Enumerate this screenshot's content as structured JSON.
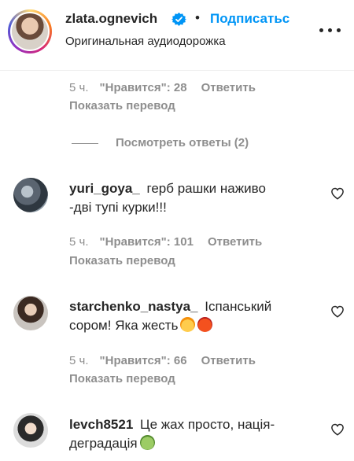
{
  "header": {
    "username": "zlata.ognevich",
    "separator": "•",
    "follow_label": "Подписатьс",
    "audio_label": "Оригинальная аудиодорожка"
  },
  "prev_comment": {
    "time": "5 ч.",
    "likes": "\"Нравится\": 28",
    "reply_label": "Ответить",
    "translate_label": "Показать перевод"
  },
  "view_replies_label": "Посмотреть ответы (2)",
  "comments": [
    {
      "user": "yuri_goya_",
      "text_line1": "герб рашки наживо",
      "text_line2": "-дві тупі курки!!!",
      "time": "5 ч.",
      "likes": "\"Нравится\": 101",
      "reply_label": "Ответить",
      "translate_label": "Показать перевод"
    },
    {
      "user": "starchenko_nastya_",
      "text_line1": "Іспанський",
      "text_line2": "сором! Яка жесть",
      "time": "5 ч.",
      "likes": "\"Нравится\": 66",
      "reply_label": "Ответить",
      "translate_label": "Показать перевод"
    },
    {
      "user": "levch8521",
      "text_line1": "Це жах просто, нація-",
      "text_line2": "деградація",
      "time": "",
      "likes": "",
      "reply_label": "",
      "translate_label": ""
    }
  ],
  "colors": {
    "link_blue": "#0095f6",
    "meta_gray": "#8e8e8e",
    "text": "#262626"
  },
  "icons": [
    "verified-badge-icon",
    "more-options-icon",
    "heart-outline-icon",
    "exploding-head-emoji",
    "angry-face-emoji",
    "nauseated-face-emoji"
  ]
}
